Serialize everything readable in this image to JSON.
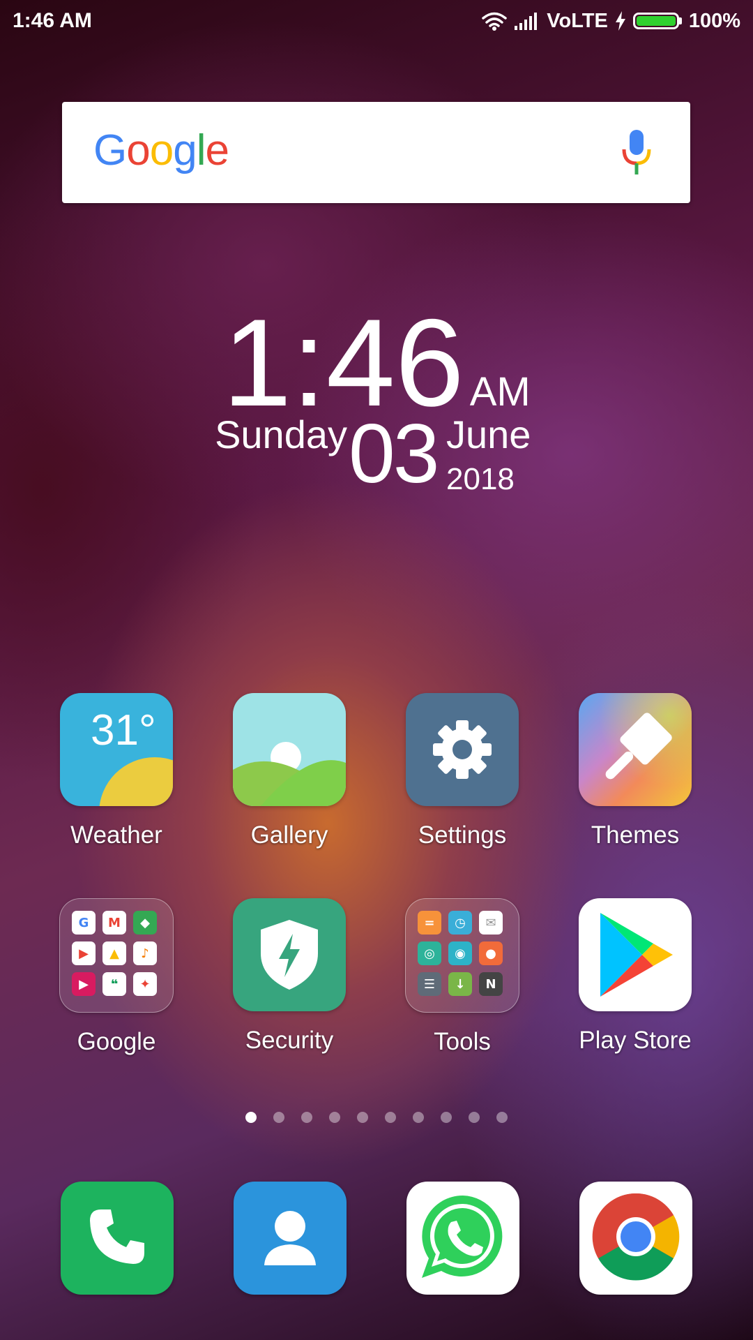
{
  "status_bar": {
    "time": "1:46 AM",
    "network": "VoLTE",
    "battery_level": "100%",
    "battery_fraction": 1.0
  },
  "search": {
    "logo_text": "Google",
    "logo_colors": [
      "#4285F4",
      "#EA4335",
      "#FBBC05",
      "#4285F4",
      "#34A853",
      "#EA4335"
    ],
    "voice_icon": "mic-icon"
  },
  "clock_widget": {
    "time": "1:46",
    "ampm": "AM",
    "weekday": "Sunday",
    "day": "03",
    "month": "June",
    "year": "2018"
  },
  "home_apps": [
    {
      "label": "Weather",
      "icon": "weather-icon",
      "temperature": "31°"
    },
    {
      "label": "Gallery",
      "icon": "gallery-icon"
    },
    {
      "label": "Settings",
      "icon": "gear-icon"
    },
    {
      "label": "Themes",
      "icon": "paintbrush-icon"
    },
    {
      "label": "Google",
      "icon": "folder-icon"
    },
    {
      "label": "Security",
      "icon": "shield-icon"
    },
    {
      "label": "Tools",
      "icon": "folder-icon"
    },
    {
      "label": "Play Store",
      "icon": "play-store-icon"
    }
  ],
  "page_indicator": {
    "total": 10,
    "active": 0
  },
  "dock": [
    {
      "icon": "phone-icon",
      "color": "#1db35e"
    },
    {
      "icon": "contacts-icon",
      "color": "#2b94dc"
    },
    {
      "icon": "whatsapp-icon",
      "color": "#ffffff"
    },
    {
      "icon": "chrome-icon",
      "color": "#ffffff"
    }
  ]
}
